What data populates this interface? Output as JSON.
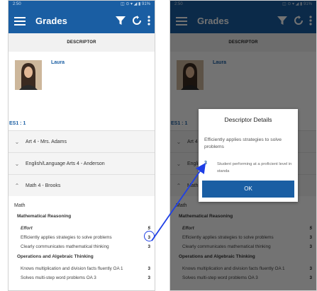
{
  "app": {
    "title": "Grades",
    "status_left": "2:50",
    "status_right": "◫ ⊙ ▾ ◢ ▮ 91%"
  },
  "subheader": "DESCRIPTOR",
  "student": {
    "name": "Laura"
  },
  "section_label": "ES1 : 1",
  "courses": [
    {
      "label": "Art 4 - Mrs. Adams",
      "expanded": false
    },
    {
      "label": "English/Language Arts 4 - Anderson",
      "expanded": false
    },
    {
      "label": "Math 4 - Brooks",
      "expanded": true
    }
  ],
  "detail": {
    "subject": "Math",
    "groups": [
      {
        "heading": "Mathematical Reasoning",
        "rows": [
          {
            "label": "Effort",
            "value": "5"
          },
          {
            "label": "Efficiently applies strategies to solve problems",
            "value": "3"
          },
          {
            "label": "Clearly communicates mathematical thinking",
            "value": "3"
          }
        ]
      },
      {
        "heading": "Operations and Algebraic Thinking",
        "rows": [
          {
            "label": "Knows multiplication and division facts fluently OA 1",
            "value": "3"
          },
          {
            "label": "Solves multi-step word problems OA 3",
            "value": "3"
          }
        ]
      }
    ]
  },
  "dialog": {
    "title": "Descriptor Details",
    "text": "Efficiently applies strategies to solve problems",
    "score": "3",
    "score_desc": "Student performing at a proficient level in standa",
    "ok_label": "OK"
  },
  "colors": {
    "primary": "#1a5ea3",
    "annotation": "#1e3fe6"
  }
}
